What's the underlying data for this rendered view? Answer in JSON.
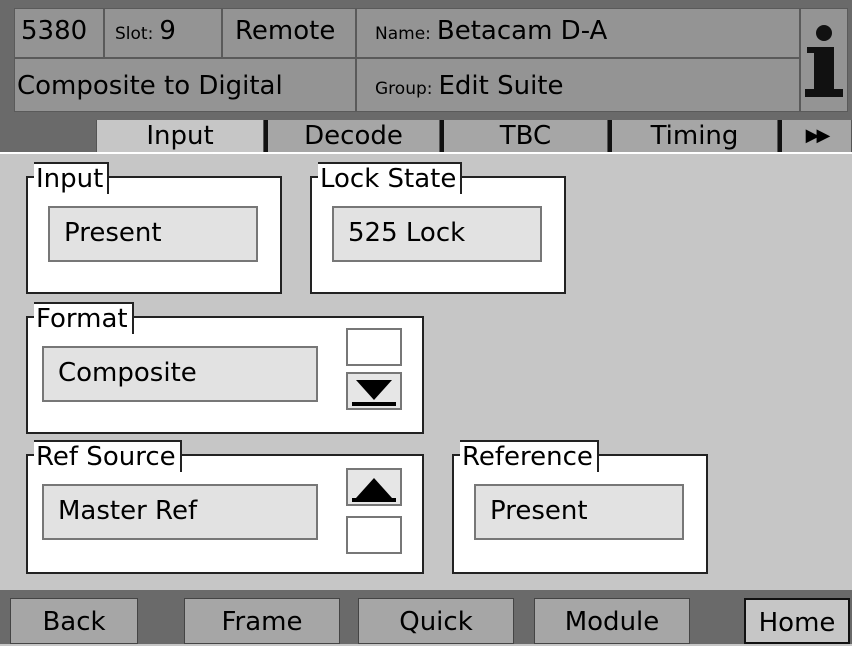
{
  "header": {
    "module_number": "5380",
    "slot_label": "Slot:",
    "slot_value": "9",
    "mode": "Remote",
    "name_label": "Name:",
    "name_value": "Betacam D-A",
    "module_type": "Composite to Digital",
    "group_label": "Group:",
    "group_value": "Edit Suite",
    "info_icon": "info-icon"
  },
  "tabs": [
    {
      "label": "Input",
      "active": true
    },
    {
      "label": "Decode",
      "active": false
    },
    {
      "label": "TBC",
      "active": false
    },
    {
      "label": "Timing",
      "active": false
    }
  ],
  "tab_more": "▶▶",
  "panels": {
    "input": {
      "label": "Input",
      "value": "Present"
    },
    "lock_state": {
      "label": "Lock State",
      "value": "525 Lock"
    },
    "format": {
      "label": "Format",
      "value": "Composite",
      "control_icon": "down-arrow-icon"
    },
    "ref_source": {
      "label": "Ref Source",
      "value": "Master Ref",
      "control_icon": "up-arrow-icon"
    },
    "reference": {
      "label": "Reference",
      "value": "Present"
    }
  },
  "footer": {
    "back": "Back",
    "frame": "Frame",
    "quick": "Quick",
    "module": "Module",
    "home": "Home"
  },
  "colors": {
    "background": "#c6c6c6",
    "header_bar": "#6a6a6a",
    "header_cell": "#949494",
    "tab_inactive": "#a6a6a6",
    "value_box": "#e2e2e2"
  }
}
